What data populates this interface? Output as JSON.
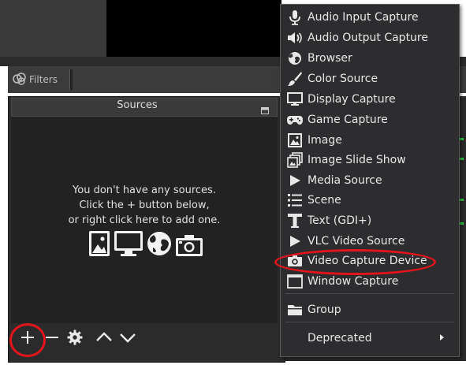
{
  "filters": {
    "label": "Filters"
  },
  "sources": {
    "title": "Sources",
    "empty_lines": [
      "You don't have any sources.",
      "Click the + button below,",
      "or right click here to add one."
    ]
  },
  "menu": {
    "items": [
      {
        "label": "Audio Input Capture",
        "icon": "microphone-icon"
      },
      {
        "label": "Audio Output Capture",
        "icon": "speaker-icon"
      },
      {
        "label": "Browser",
        "icon": "globe-icon"
      },
      {
        "label": "Color Source",
        "icon": "paintbrush-icon"
      },
      {
        "label": "Display Capture",
        "icon": "monitor-icon"
      },
      {
        "label": "Game Capture",
        "icon": "gamepad-icon"
      },
      {
        "label": "Image",
        "icon": "image-icon"
      },
      {
        "label": "Image Slide Show",
        "icon": "slideshow-icon"
      },
      {
        "label": "Media Source",
        "icon": "play-icon"
      },
      {
        "label": "Scene",
        "icon": "list-icon"
      },
      {
        "label": "Text (GDI+)",
        "icon": "text-icon"
      },
      {
        "label": "VLC Video Source",
        "icon": "play-icon"
      },
      {
        "label": "Video Capture Device",
        "icon": "camera-icon"
      },
      {
        "label": "Window Capture",
        "icon": "window-icon"
      }
    ],
    "group": {
      "label": "Group",
      "icon": "folder-icon"
    },
    "deprecated": {
      "label": "Deprecated"
    }
  },
  "colors": {
    "annotation": "#e3141b",
    "menu_bg": "#2d2d30",
    "panel_bg": "#2b2b2b"
  }
}
